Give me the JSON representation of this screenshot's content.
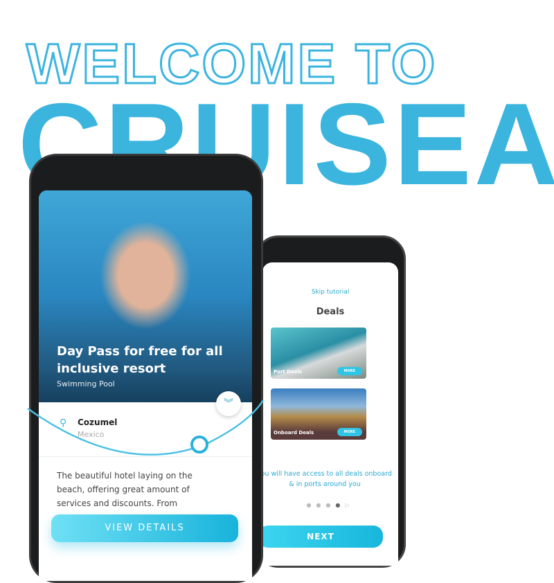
{
  "headline": {
    "line1": "WELCOME TO",
    "line2": "CRUISEA"
  },
  "colors": {
    "brand": "#3bb4de",
    "button": "#18b3db"
  },
  "back_phone": {
    "skip": "Skip tutorial",
    "title": "Deals",
    "cards": [
      {
        "label": "Port Deals",
        "button": "MORE"
      },
      {
        "label": "Onboard Deals",
        "button": "MORE"
      }
    ],
    "message": "You will have access to all deals onboard & in ports around you",
    "pagination": {
      "total": 5,
      "active": 4
    },
    "next": "NEXT"
  },
  "front_phone": {
    "hero_title": "Day Pass for free for all inclusive resort",
    "hero_subtitle": "Swimming Pool",
    "expand_icon": "chevron-double-down-icon",
    "location_icon": "map-pin-icon",
    "city": "Cozumel",
    "country": "Mexico",
    "description": "The beautiful hotel laying on the beach, offering great amount of services and discounts. From",
    "cta": "VIEW DETAILS"
  }
}
